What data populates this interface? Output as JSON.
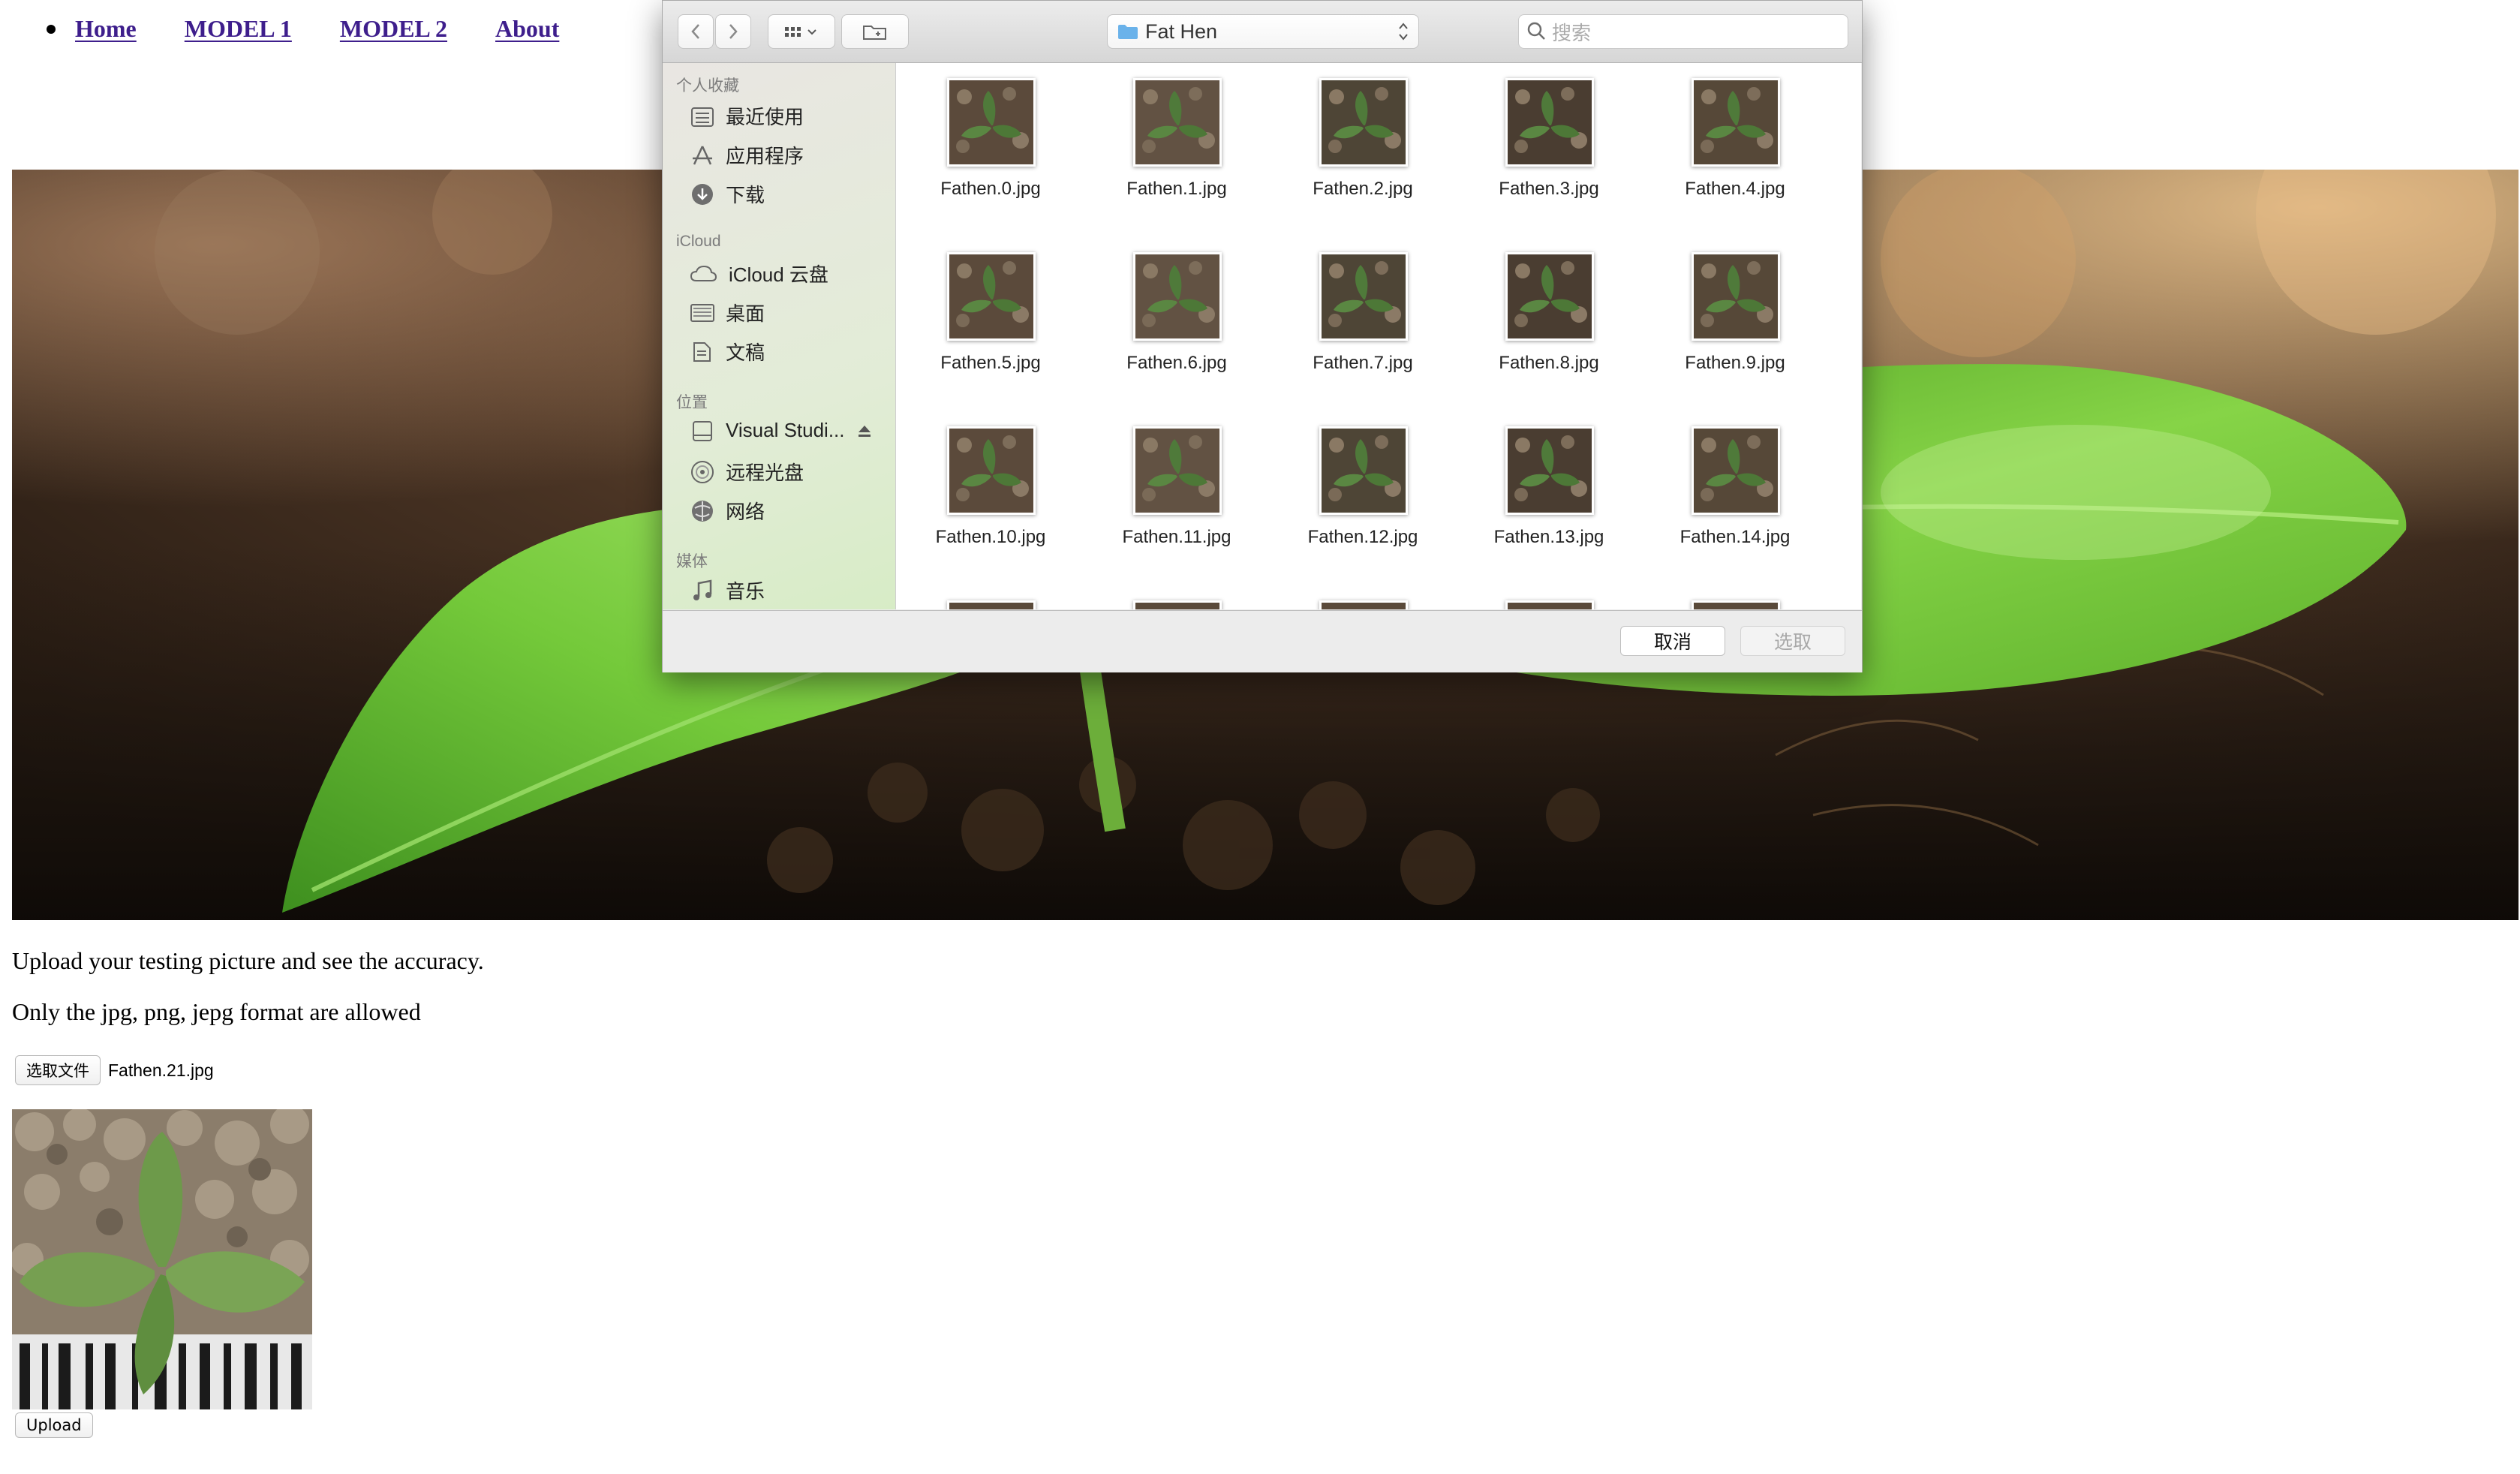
{
  "nav": {
    "items": [
      {
        "label": "Home"
      },
      {
        "label": "MODEL 1"
      },
      {
        "label": "MODEL 2"
      },
      {
        "label": "About"
      }
    ]
  },
  "page": {
    "instruction_1": "Upload your testing picture and see the accuracy.",
    "instruction_2": "Only the jpg, png, jepg format are allowed",
    "choose_file_label": "选取文件",
    "selected_file": "Fathen.21.jpg",
    "upload_label": "Upload"
  },
  "dialog": {
    "location": "Fat Hen",
    "search_placeholder": "搜索",
    "sidebar": {
      "favorites_header": "个人收藏",
      "favorites": [
        {
          "label": "最近使用",
          "icon": "recents-icon"
        },
        {
          "label": "应用程序",
          "icon": "applications-icon"
        },
        {
          "label": "下载",
          "icon": "downloads-icon"
        }
      ],
      "icloud_header": "iCloud",
      "icloud": [
        {
          "label": "iCloud 云盘",
          "icon": "icloud-drive-icon"
        },
        {
          "label": "桌面",
          "icon": "desktop-icon"
        },
        {
          "label": "文稿",
          "icon": "documents-icon"
        }
      ],
      "locations_header": "位置",
      "locations": [
        {
          "label": "Visual Studi...",
          "icon": "drive-icon"
        },
        {
          "label": "远程光盘",
          "icon": "remote-disc-icon"
        },
        {
          "label": "网络",
          "icon": "network-icon"
        }
      ],
      "media_header": "媒体",
      "media": [
        {
          "label": "音乐",
          "icon": "music-icon"
        }
      ]
    },
    "files": [
      "Fathen.0.jpg",
      "Fathen.1.jpg",
      "Fathen.2.jpg",
      "Fathen.3.jpg",
      "Fathen.4.jpg",
      "Fathen.5.jpg",
      "Fathen.6.jpg",
      "Fathen.7.jpg",
      "Fathen.8.jpg",
      "Fathen.9.jpg",
      "Fathen.10.jpg",
      "Fathen.11.jpg",
      "Fathen.12.jpg",
      "Fathen.13.jpg",
      "Fathen.14.jpg"
    ],
    "cancel_label": "取消",
    "choose_label": "选取"
  },
  "colors": {
    "nav_link": "#3e1e8c",
    "leaf_green": "#6fc43a",
    "folder_blue": "#6ab2ea"
  }
}
